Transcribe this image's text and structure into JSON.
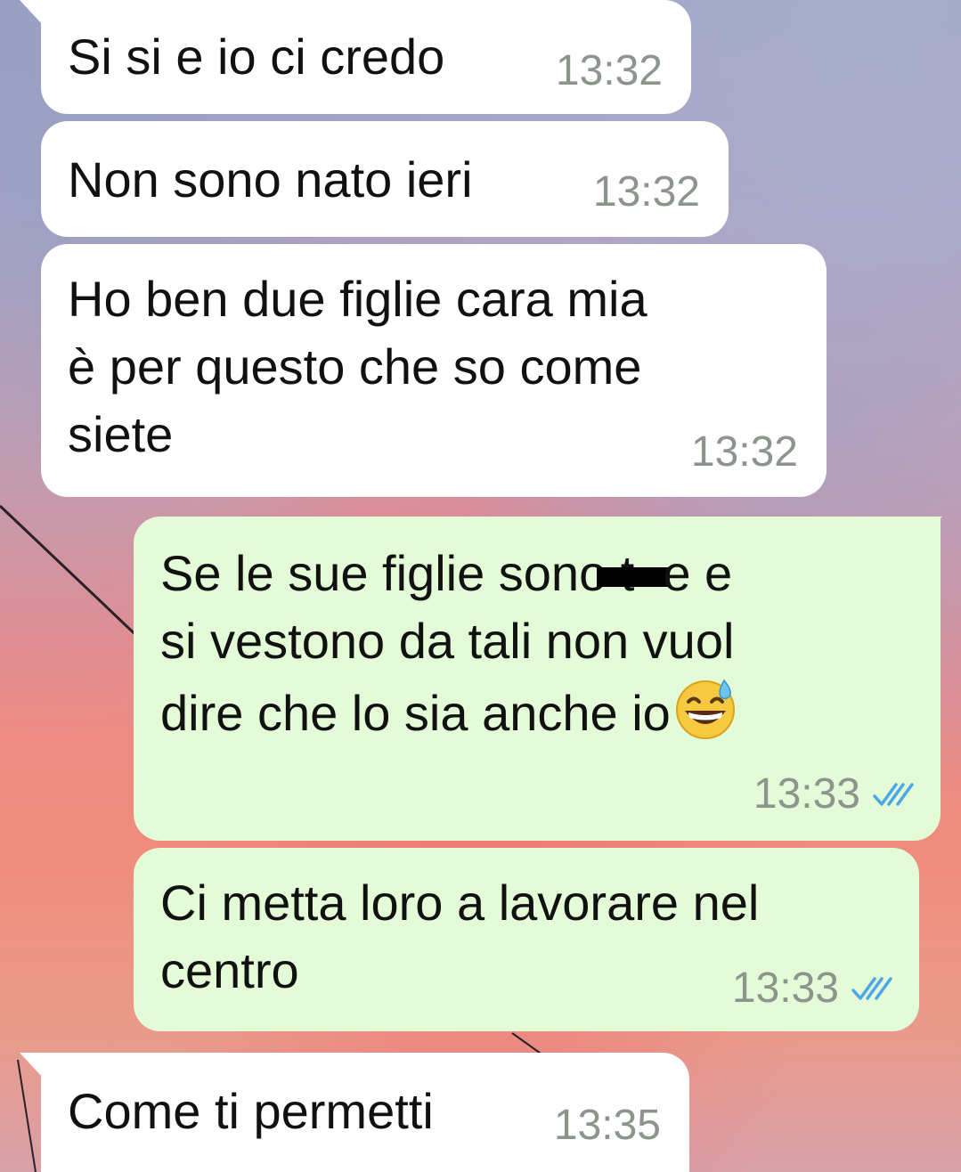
{
  "chat": {
    "messages": [
      {
        "direction": "incoming",
        "text": "Si si e io ci credo",
        "time": "13:32"
      },
      {
        "direction": "incoming",
        "text": "Non sono nato ieri",
        "time": "13:32"
      },
      {
        "direction": "incoming",
        "text": "Ho ben due figlie cara mia\nè per questo che so come\nsiete",
        "time": "13:32"
      },
      {
        "direction": "outgoing",
        "text_parts": [
          "Se le sue figlie sono t",
          "e e\nsi vestono da tali non vuol\ndire che lo sia anche io"
        ],
        "emoji": "sweat-smile-emoji",
        "time": "13:33",
        "status": "read"
      },
      {
        "direction": "outgoing",
        "text": "Ci metta loro a lavorare nel\ncentro",
        "time": "13:33",
        "status": "read"
      },
      {
        "direction": "incoming",
        "text": "Come ti permetti",
        "time": "13:35"
      }
    ]
  },
  "colors": {
    "incoming_bubble": "#ffffff",
    "outgoing_bubble": "#e3fbd6",
    "timestamp": "#8c948d",
    "read_tick": "#4aa8e8"
  }
}
